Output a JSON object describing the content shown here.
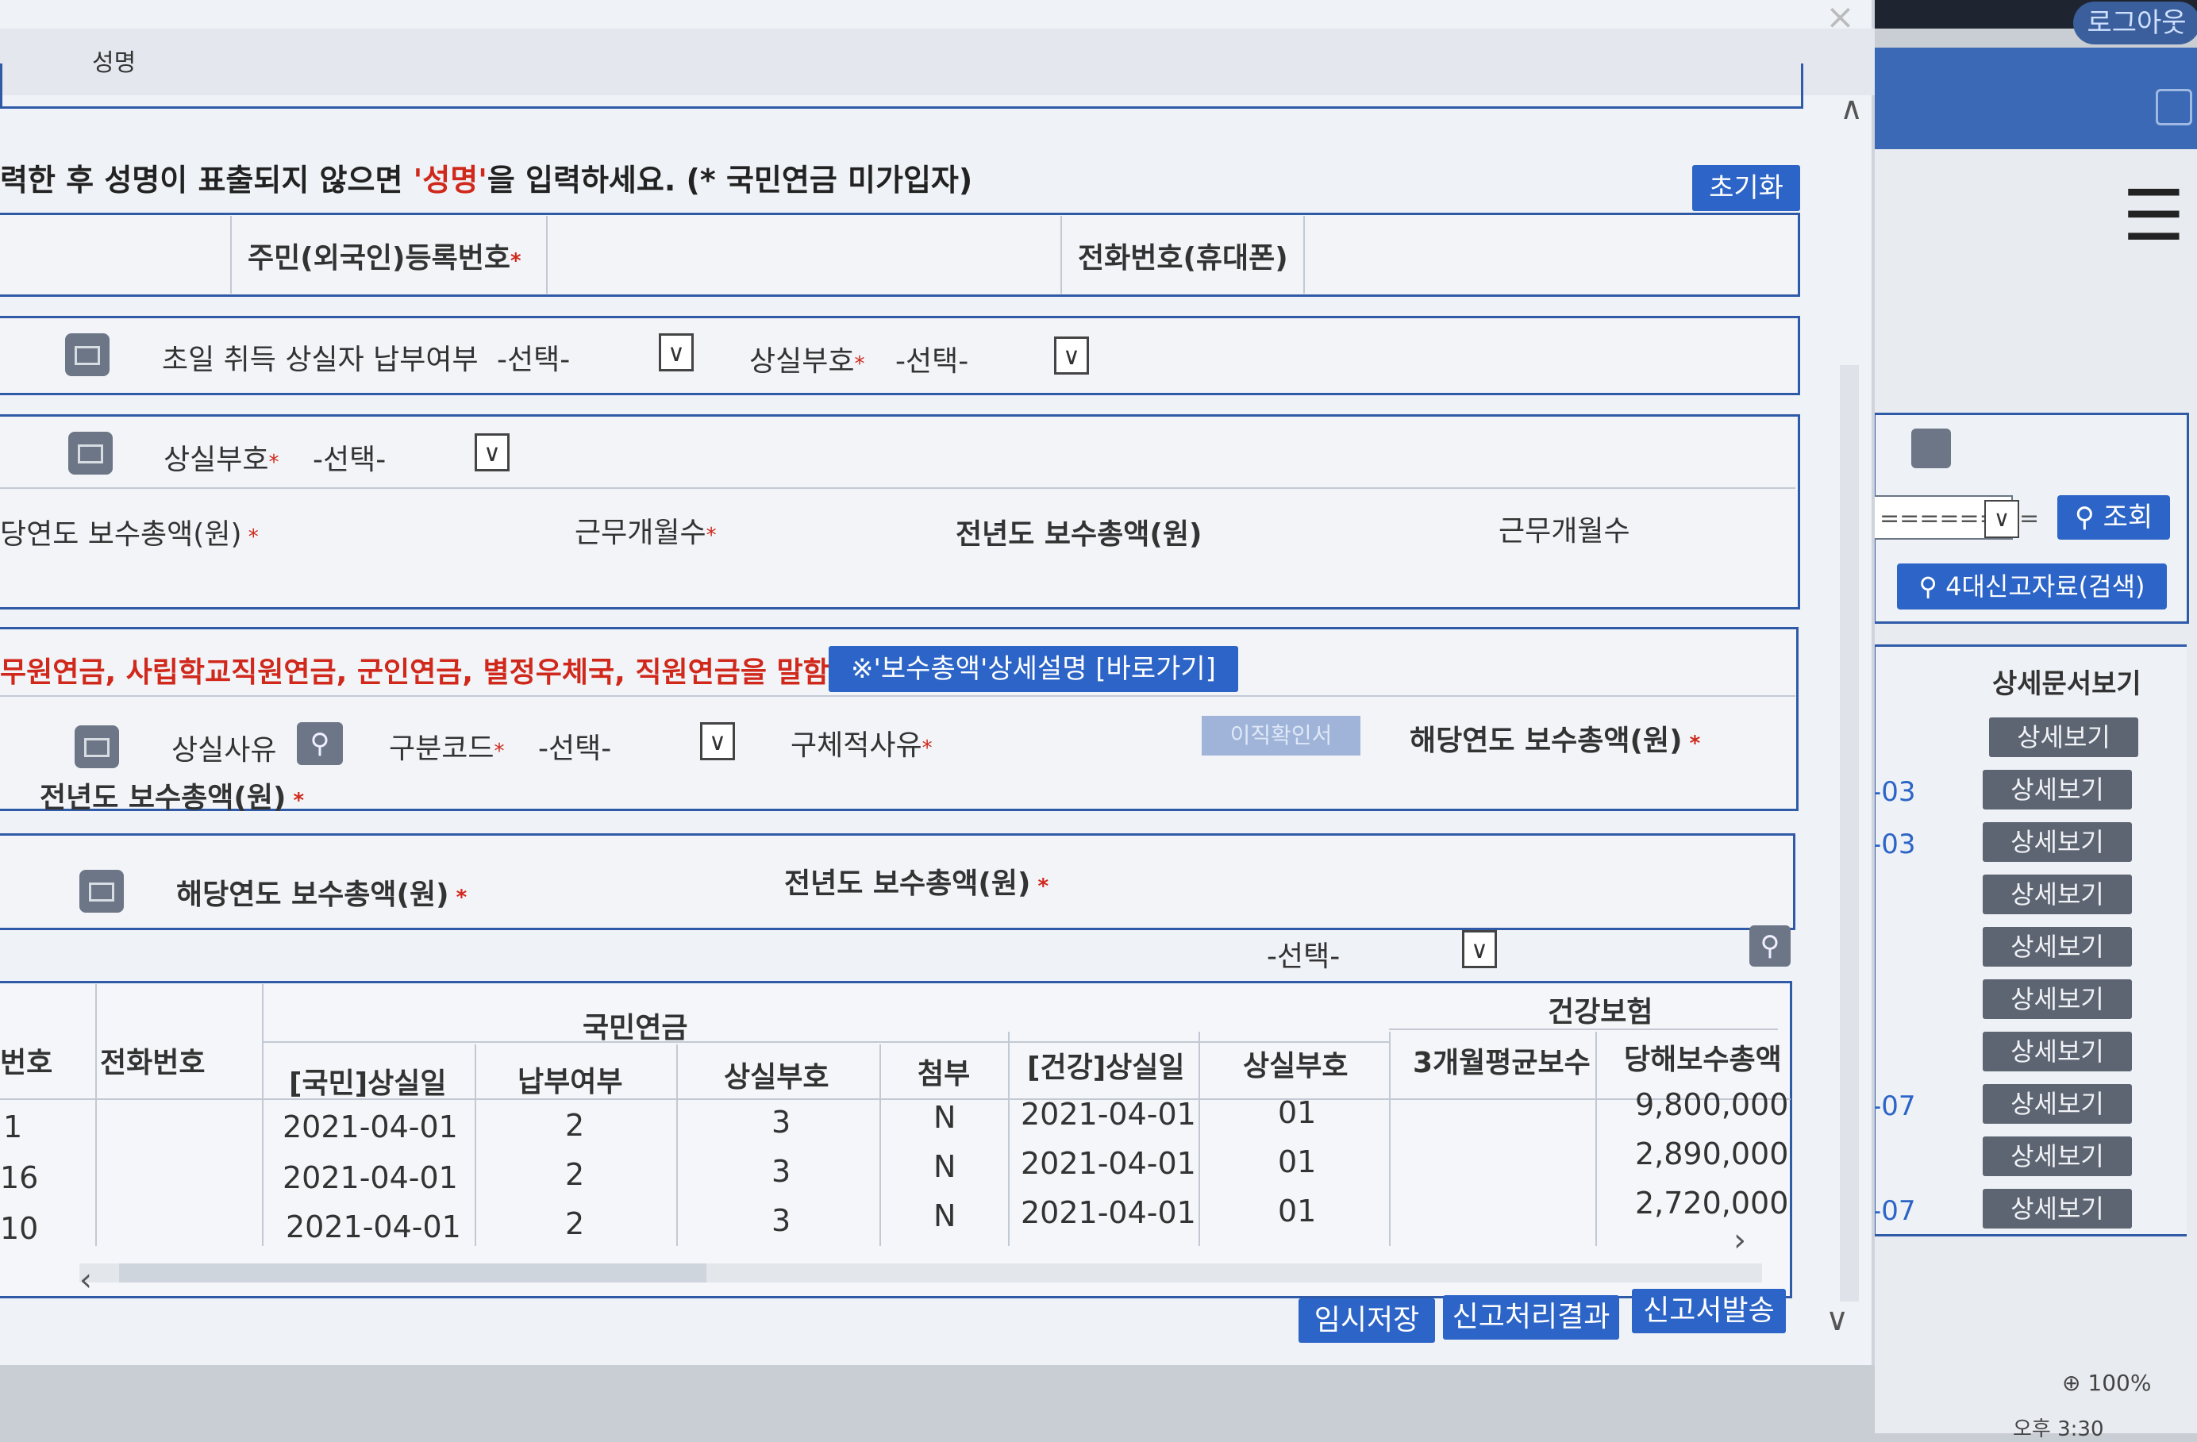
{
  "header": {
    "logout_label": "로그아웃"
  },
  "modal": {
    "title": "성명",
    "notice_pre": "력한 후 성명이 표출되지 않으면 ",
    "notice_red": "'성명'",
    "notice_post": "을 입력하세요. (* 국민연금 미가입자)",
    "reset_label": "초기화",
    "section1": {
      "rrn_label": "주민(외국인)등록번호",
      "phone_label": "전화번호(휴대폰)"
    },
    "section2": {
      "first_day_label": "초일 취득 상실자 납부여부",
      "first_day_value": "-선택-",
      "loss_code_label": "상실부호",
      "loss_code_value": "-선택-"
    },
    "section3": {
      "loss_code_label": "상실부호",
      "loss_code_value": "-선택-",
      "cur_year_total_label": "당연도 보수총액(원)",
      "work_months_label": "근무개월수",
      "prev_year_total_label": "전년도 보수총액(원)",
      "prev_work_months_label": "근무개월수"
    },
    "section4": {
      "red_notice": "무원연금, 사립학교직원연금, 군인연금, 별정우체국, 직원연금을 말함.",
      "goto_label": "※'보수총액'상세설명 [바로가기]",
      "loss_reason_label": "상실사유",
      "category_label": "구분코드",
      "category_value": "-선택-",
      "specific_reason_label": "구체적사유",
      "faded_button_label": "이직확인서",
      "cur_year_total_label": "해당연도 보수총액(원)",
      "prev_year_total_label": "전년도 보수총액(원)"
    },
    "section5": {
      "cur_year_total_label": "해당연도 보수총액(원)",
      "prev_year_total_label": "전년도 보수총액(원)"
    },
    "filter_value": "-선택-",
    "table": {
      "group_pension": "국민연금",
      "group_health": "건강보험",
      "headers": [
        "번호",
        "전화번호",
        "[국민]상실일",
        "납부여부",
        "상실부호",
        "첨부",
        "[건강]상실일",
        "상실부호",
        "3개월평균보수",
        "당해보수총액"
      ],
      "rows": [
        {
          "no": "1",
          "phone": "",
          "np_loss_date": "2021-04-01",
          "paid": "2",
          "np_code": "3",
          "attach": "N",
          "hi_loss_date": "2021-04-01",
          "hi_code": "01",
          "avg3": "",
          "total": "9,800,000"
        },
        {
          "no": "16",
          "phone": "",
          "np_loss_date": "2021-04-01",
          "paid": "2",
          "np_code": "3",
          "attach": "N",
          "hi_loss_date": "2021-04-01",
          "hi_code": "01",
          "avg3": "",
          "total": "2,890,000"
        },
        {
          "no": "10",
          "phone": "",
          "np_loss_date": "2021-04-01",
          "paid": "2",
          "np_code": "3",
          "attach": "N",
          "hi_loss_date": "2021-04-01",
          "hi_code": "01",
          "avg3": "",
          "total": "2,720,000"
        }
      ]
    },
    "buttons": {
      "save": "임시저장",
      "result": "신고처리결과",
      "send": "신고서발송"
    }
  },
  "background": {
    "select_value": "========",
    "search_label": "조회",
    "search_4dae_label": "4대신고자료(검색)",
    "detail_col_header": "상세문서보기",
    "detail_label": "상세보기",
    "dates": [
      "-03",
      "-03",
      "-07",
      "-07"
    ],
    "zoom": "100%",
    "time": "오후 3:30"
  }
}
